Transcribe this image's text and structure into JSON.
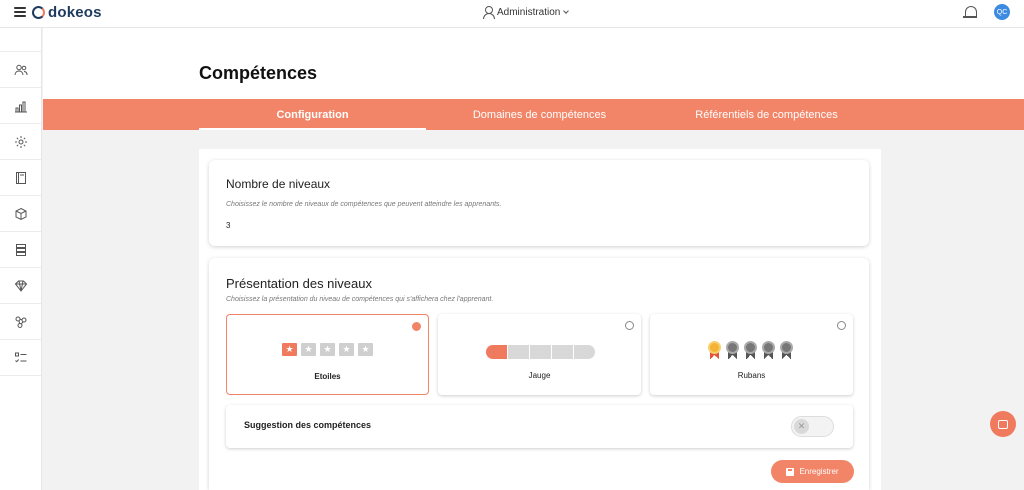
{
  "brand": {
    "name": "dokeos"
  },
  "header": {
    "admin_label": "Administration",
    "avatar_initials": "QC"
  },
  "sidebar": {
    "items": [
      {
        "icon": "users-icon"
      },
      {
        "icon": "bar-chart-icon"
      },
      {
        "icon": "gear-icon"
      },
      {
        "icon": "book-icon"
      },
      {
        "icon": "cube-icon"
      },
      {
        "icon": "database-icon"
      },
      {
        "icon": "diamond-icon"
      },
      {
        "icon": "network-icon"
      },
      {
        "icon": "checklist-icon"
      }
    ]
  },
  "page": {
    "title": "Compétences"
  },
  "tabs": [
    {
      "label": "Configuration",
      "active": true
    },
    {
      "label": "Domaines de compétences",
      "active": false
    },
    {
      "label": "Référentiels de compétences",
      "active": false
    }
  ],
  "levels": {
    "title": "Nombre de niveaux",
    "description": "Choisissez le nombre de niveaux de compétences que peuvent atteindre les apprenants.",
    "value": "3"
  },
  "presentation": {
    "title": "Présentation des niveaux",
    "description": "Choisissez la présentation du niveau de compétences qui s'affichera chez l'apprenant.",
    "options": [
      {
        "label": "Etoiles",
        "selected": true
      },
      {
        "label": "Jauge",
        "selected": false
      },
      {
        "label": "Rubans",
        "selected": false
      }
    ]
  },
  "suggestion": {
    "label": "Suggestion des compétences",
    "enabled": false
  },
  "save_button": {
    "label": "Enregistrer"
  },
  "colors": {
    "accent": "#f28467",
    "brand_dark": "#1f3a5f"
  }
}
